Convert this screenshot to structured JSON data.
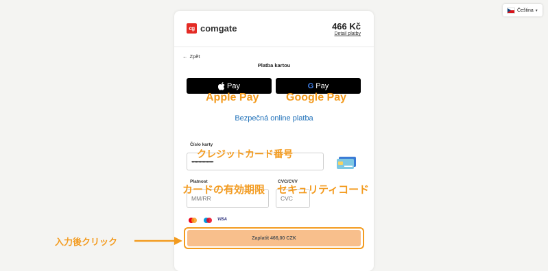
{
  "language": {
    "label": "Čeština",
    "flag_icon": "czech-flag-icon",
    "chevron_icon": "chevron-down-icon"
  },
  "header": {
    "logo_mark": "cg",
    "brand": "comgate",
    "amount": "466 Kč",
    "detail_link": "Detail platby"
  },
  "nav": {
    "back_label": "Zpět"
  },
  "page": {
    "title": "Platba kartou"
  },
  "wallets": {
    "apple_label": "Pay",
    "google_label": "Pay"
  },
  "annotations": {
    "apple": "Apple Pay",
    "google": "Google Pay",
    "card_number": "クレジットカード番号",
    "expiry": "カードの有効期限",
    "cvc": "セキュリティコード",
    "click_after": "入力後クリック"
  },
  "secure_text": "Bezpečná online platba",
  "form": {
    "card_number_label": "Číslo karty",
    "card_number_value": "••••••••••••••••",
    "expiry_label": "Platnost",
    "expiry_placeholder": "MM/RR",
    "cvc_label": "CVC/CVV",
    "cvc_placeholder": "CVC"
  },
  "card_brands": [
    "mastercard-icon",
    "maestro-icon",
    "visa-icon"
  ],
  "visa_text": "VISA",
  "pay_button": {
    "label": "Zaplatit 466,00 CZK"
  },
  "colors": {
    "accent": "#f39b1f",
    "brand_red": "#e42b25",
    "link_blue": "#1d6fb8",
    "pay_button": "#f8bf8c"
  }
}
